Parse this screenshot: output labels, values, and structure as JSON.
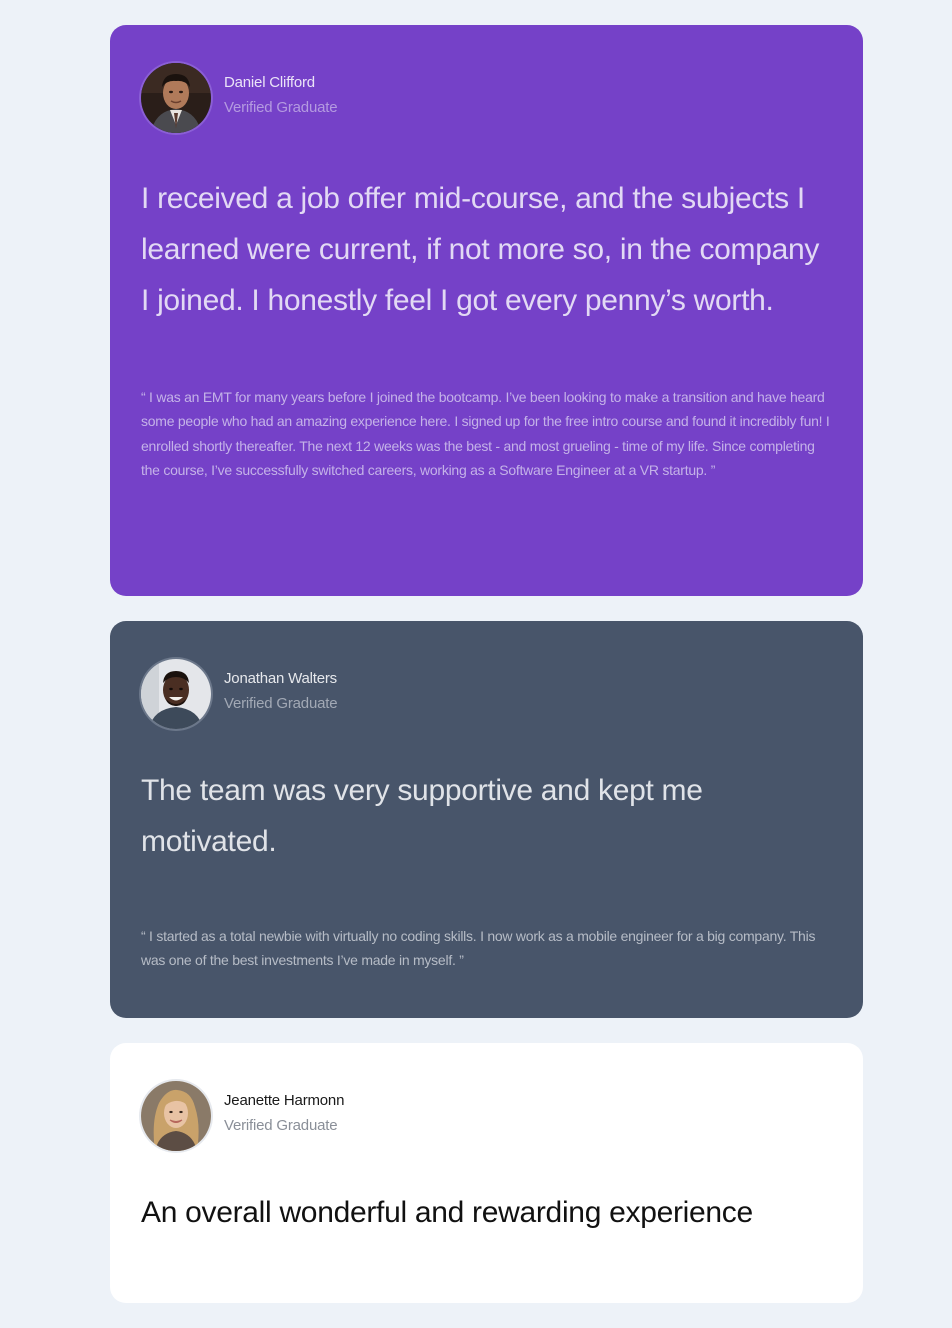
{
  "colors": {
    "page_background": "#edf2f8",
    "card_purple": "#7541c8",
    "card_slate": "#48556a",
    "card_white": "#ffffff"
  },
  "testimonials": [
    {
      "name": "Daniel Clifford",
      "role": "Verified Graduate",
      "headline": "I received a job offer mid-course, and the subjects I learned were current, if not more so, in the company I joined. I honestly feel I got every penny’s worth.",
      "quote": "“ I was an EMT for many years before I joined the bootcamp. I’ve been looking to make a transition and have heard some people who had an amazing experience here. I signed up for the free intro course and found it incredibly fun! I enrolled shortly thereafter. The next 12 weeks was the best - and most grueling - time of my life. Since completing the course, I’ve successfully switched careers, working as a Software Engineer at a VR startup. ”"
    },
    {
      "name": "Jonathan Walters",
      "role": "Verified Graduate",
      "headline": "The team was very supportive and kept me motivated.",
      "quote": "“ I started as a total newbie with virtually no coding skills. I now work as a mobile engineer for a big company. This was one of the best investments I’ve made in myself. ”"
    },
    {
      "name": "Jeanette Harmonn",
      "role": "Verified Graduate",
      "headline": "An overall wonderful and rewarding experience"
    }
  ]
}
